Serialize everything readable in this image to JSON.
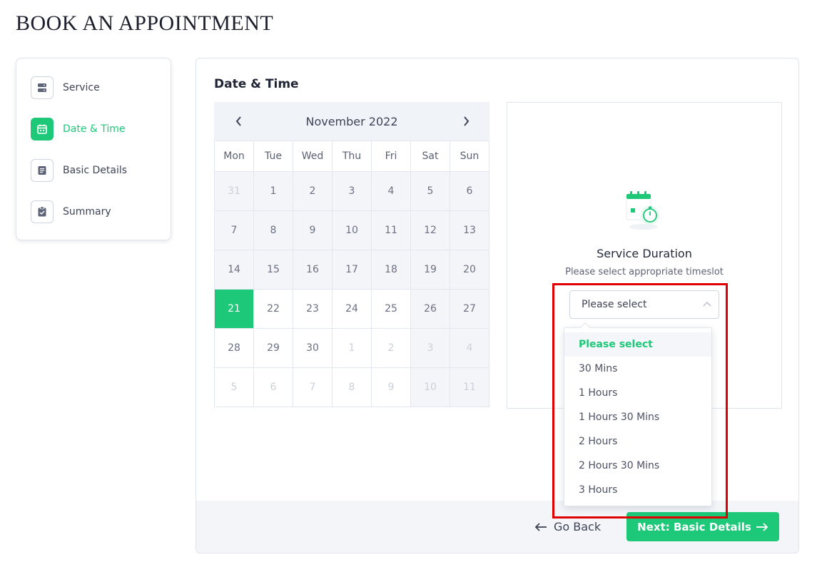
{
  "page": {
    "title": "BOOK AN APPOINTMENT"
  },
  "sidebar": {
    "items": [
      {
        "label": "Service",
        "icon": "server-icon",
        "active": false
      },
      {
        "label": "Date & Time",
        "icon": "calendar-icon",
        "active": true
      },
      {
        "label": "Basic Details",
        "icon": "document-icon",
        "active": false
      },
      {
        "label": "Summary",
        "icon": "clipboard-check-icon",
        "active": false
      }
    ]
  },
  "main": {
    "section_title": "Date & Time",
    "calendar": {
      "month_label": "November 2022",
      "weekdays": [
        "Mon",
        "Tue",
        "Wed",
        "Thu",
        "Fri",
        "Sat",
        "Sun"
      ],
      "days": [
        {
          "label": "31",
          "muted": true,
          "white": false
        },
        {
          "label": "1",
          "muted": false,
          "white": false
        },
        {
          "label": "2",
          "muted": false,
          "white": false
        },
        {
          "label": "3",
          "muted": false,
          "white": false
        },
        {
          "label": "4",
          "muted": false,
          "white": false
        },
        {
          "label": "5",
          "muted": false,
          "white": false
        },
        {
          "label": "6",
          "muted": false,
          "white": false
        },
        {
          "label": "7",
          "muted": false,
          "white": false
        },
        {
          "label": "8",
          "muted": false,
          "white": false
        },
        {
          "label": "9",
          "muted": false,
          "white": false
        },
        {
          "label": "10",
          "muted": false,
          "white": false
        },
        {
          "label": "11",
          "muted": false,
          "white": false
        },
        {
          "label": "12",
          "muted": false,
          "white": false
        },
        {
          "label": "13",
          "muted": false,
          "white": false
        },
        {
          "label": "14",
          "muted": false,
          "white": false
        },
        {
          "label": "15",
          "muted": false,
          "white": false
        },
        {
          "label": "16",
          "muted": false,
          "white": false
        },
        {
          "label": "17",
          "muted": false,
          "white": false
        },
        {
          "label": "18",
          "muted": false,
          "white": false
        },
        {
          "label": "19",
          "muted": false,
          "white": false
        },
        {
          "label": "20",
          "muted": false,
          "white": false
        },
        {
          "label": "21",
          "muted": false,
          "white": false,
          "selected": true
        },
        {
          "label": "22",
          "muted": false,
          "white": true
        },
        {
          "label": "23",
          "muted": false,
          "white": true
        },
        {
          "label": "24",
          "muted": false,
          "white": true
        },
        {
          "label": "25",
          "muted": false,
          "white": true
        },
        {
          "label": "26",
          "muted": false,
          "white": false
        },
        {
          "label": "27",
          "muted": false,
          "white": false
        },
        {
          "label": "28",
          "muted": false,
          "white": true
        },
        {
          "label": "29",
          "muted": false,
          "white": true
        },
        {
          "label": "30",
          "muted": false,
          "white": true
        },
        {
          "label": "1",
          "muted": true,
          "white": true
        },
        {
          "label": "2",
          "muted": true,
          "white": true
        },
        {
          "label": "3",
          "muted": true,
          "white": false
        },
        {
          "label": "4",
          "muted": true,
          "white": false
        },
        {
          "label": "5",
          "muted": true,
          "white": true
        },
        {
          "label": "6",
          "muted": true,
          "white": true
        },
        {
          "label": "7",
          "muted": true,
          "white": true
        },
        {
          "label": "8",
          "muted": true,
          "white": true
        },
        {
          "label": "9",
          "muted": true,
          "white": true
        },
        {
          "label": "10",
          "muted": true,
          "white": false
        },
        {
          "label": "11",
          "muted": true,
          "white": false
        }
      ]
    },
    "duration": {
      "illustration_icon": "calendar-stopwatch-icon",
      "title": "Service Duration",
      "subtitle": "Please select appropriate timeslot",
      "select_value": "Please select",
      "options": [
        "Please select",
        "30 Mins",
        "1 Hours",
        "1 Hours 30 Mins",
        "2 Hours",
        "2 Hours 30 Mins",
        "3 Hours"
      ],
      "selected_index": 0
    },
    "footer": {
      "back_label": "Go Back",
      "next_label_prefix": "Next: ",
      "next_label_target": "Basic Details"
    }
  },
  "colors": {
    "accent": "#1dc878",
    "highlight": "#e00000"
  }
}
